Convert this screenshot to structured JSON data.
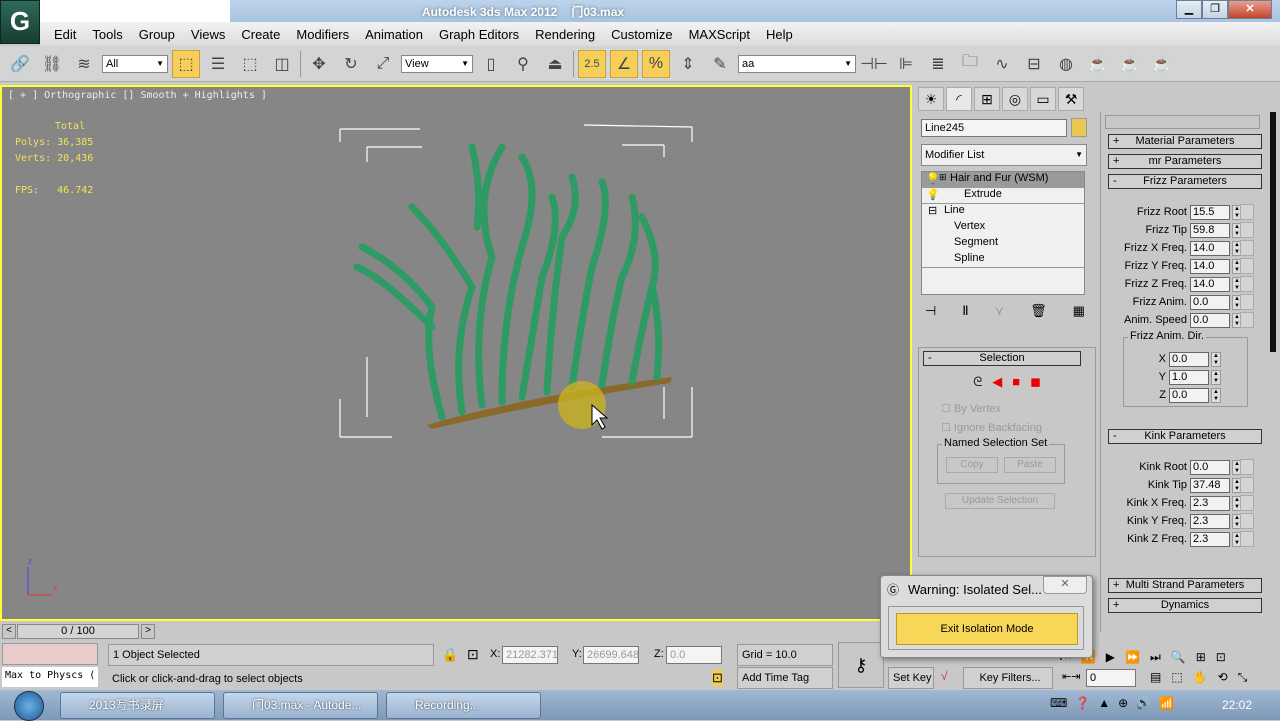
{
  "window": {
    "title": "Autodesk 3ds Max  2012",
    "file": "门03.max",
    "app_icon": "3ds-max-logo",
    "controls": [
      "minimize",
      "restore",
      "close"
    ]
  },
  "menu": [
    "Edit",
    "Tools",
    "Group",
    "Views",
    "Create",
    "Modifiers",
    "Animation",
    "Graph Editors",
    "Rendering",
    "Customize",
    "MAXScript",
    "Help"
  ],
  "toolbar": {
    "selection_filter": "All",
    "ref_coord": "View",
    "snap_angle": "2.5",
    "named_selection": "aa"
  },
  "viewport": {
    "label": "[ + ] Orthographic [] Smooth + Highlights ]",
    "stats": {
      "header": "Total",
      "polys_label": "Polys:",
      "polys": "36,385",
      "verts_label": "Verts:",
      "verts": "20,436",
      "fps_label": "FPS:",
      "fps": "46.742"
    },
    "axis": {
      "z": "z",
      "x": "x"
    },
    "hair_color": "#2e9a64",
    "border_color": "#ffff3a"
  },
  "command_panel": {
    "object_name": "Line245",
    "object_color": "#e8c850",
    "modifier_list": "Modifier List",
    "stack": [
      {
        "label": "Hair and Fur (WSM)",
        "selected": true
      },
      {
        "label": "Extrude"
      },
      {
        "label": "Line"
      },
      {
        "label": "Vertex"
      },
      {
        "label": "Segment"
      },
      {
        "label": "Spline"
      }
    ],
    "selection": {
      "title": "Selection",
      "by_vertex": "By Vertex",
      "ignore_backfacing": "Ignore Backfacing",
      "named_set": "Named Selection Set",
      "copy": "Copy",
      "paste": "Paste",
      "update": "Update Selection"
    }
  },
  "params": {
    "material": "Material Parameters",
    "mr": "mr Parameters",
    "frizz_title": "Frizz Parameters",
    "frizz": [
      {
        "label": "Frizz Root",
        "value": "15.5"
      },
      {
        "label": "Frizz Tip",
        "value": "59.8"
      },
      {
        "label": "Frizz X Freq.",
        "value": "14.0"
      },
      {
        "label": "Frizz Y Freq.",
        "value": "14.0"
      },
      {
        "label": "Frizz Z Freq.",
        "value": "14.0"
      },
      {
        "label": "Frizz Anim.",
        "value": "0.0"
      },
      {
        "label": "Anim. Speed",
        "value": "0.0"
      }
    ],
    "anim_dir_title": "Frizz Anim. Dir.",
    "anim_dir": [
      {
        "label": "X",
        "value": "0.0"
      },
      {
        "label": "Y",
        "value": "1.0"
      },
      {
        "label": "Z",
        "value": "0.0"
      }
    ],
    "kink_title": "Kink Parameters",
    "kink": [
      {
        "label": "Kink Root",
        "value": "0.0"
      },
      {
        "label": "Kink Tip",
        "value": "37.48"
      },
      {
        "label": "Kink X Freq.",
        "value": "2.3"
      },
      {
        "label": "Kink Y Freq.",
        "value": "2.3"
      },
      {
        "label": "Kink Z Freq.",
        "value": "2.3"
      }
    ],
    "multi_strand": "Multi Strand Parameters",
    "dynamics": "Dynamics"
  },
  "dialog": {
    "title": "Warning: Isolated Sel...",
    "button": "Exit Isolation Mode"
  },
  "timeline": {
    "frame": "0 / 100",
    "prev": "<",
    "next": ">"
  },
  "status": {
    "script": "Max to Physcs (",
    "selected": "1 Object Selected",
    "prompt": "Click or click-and-drag to select objects",
    "x_label": "X:",
    "x": "21282.371",
    "y_label": "Y:",
    "y": "26699.648",
    "z_label": "Z:",
    "z": "0.0",
    "grid": "Grid = 10.0",
    "add_time_tag": "Add Time Tag",
    "set_key": "Set Key",
    "key_filters": "Key Filters...",
    "current_frame": "0"
  },
  "taskbar": {
    "items": [
      "2013写书录屏",
      "门03.max - Autode...",
      "Recording..."
    ],
    "clock": "22:02"
  }
}
